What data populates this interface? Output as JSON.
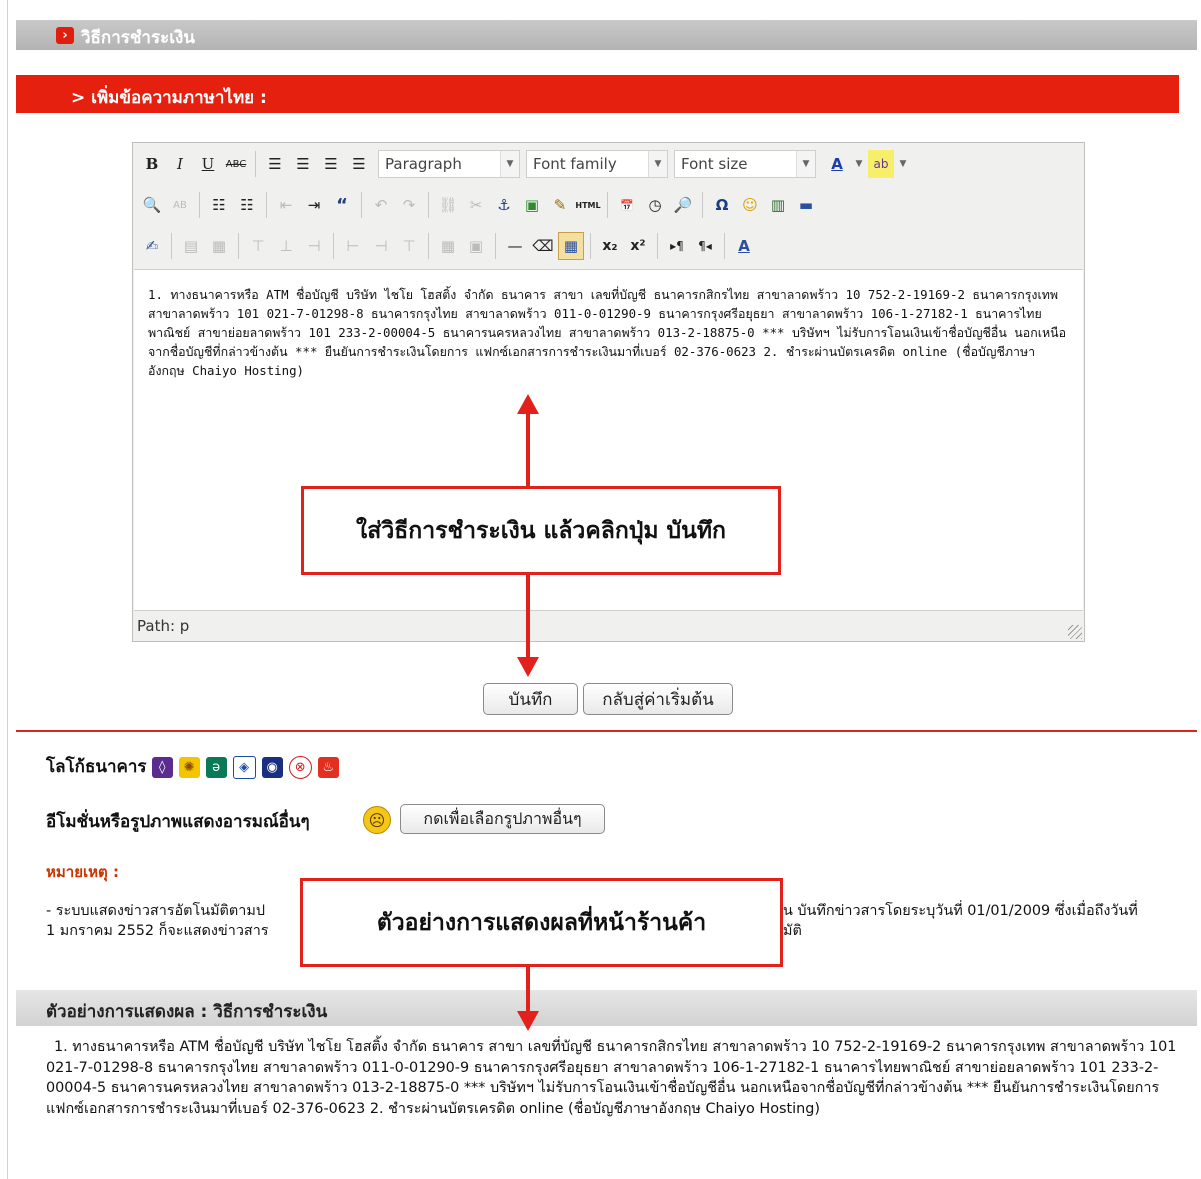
{
  "header": {
    "title": "วิธีการชำระเงิน",
    "bullet": "›"
  },
  "section": {
    "title": "> เพิ่มข้อความภาษาไทย :"
  },
  "editor": {
    "format_select": "Paragraph",
    "font_family_select": "Font family",
    "font_size_select": "Font size",
    "content": "1. ทางธนาคารหรือ ATM ชื่อบัญชี บริษัท ไชโย โฮสติ้ง จำกัด ธนาคาร สาขา เลขที่บัญชี ธนาคารกสิกรไทย สาขาลาดพร้าว 10 752-2-19169-2 ธนาคารกรุงเทพ สาขาลาดพร้าว 101 021-7-01298-8 ธนาคารกรุงไทย สาขาลาดพร้าว 011-0-01290-9 ธนาคารกรุงศรีอยุธยา สาขาลาดพร้าว 106-1-27182-1 ธนาคารไทยพาณิชย์ สาขาย่อยลาดพร้าว 101 233-2-00004-5 ธนาคารนครหลวงไทย สาขาลาดพร้าว 013-2-18875-0 *** บริษัทฯ ไม่รับการโอนเงินเข้าชื่อบัญชีอื่น นอกเหนือจากชื่อบัญชีที่กล่าวข้างต้น *** ยืนยันการชำระเงินโดยการ แฟกซ์เอกสารการชำระเงินมาที่เบอร์ 02-376-0623 2. ชำระผ่านบัตรเครดิต online (ชื่อบัญชีภาษาอังกฤษ Chaiyo Hosting)",
    "path": "Path: p"
  },
  "buttons": {
    "save": "บันทึก",
    "reset": "กลับสู่ค่าเริ่มต้น"
  },
  "callouts": {
    "top": "ใส่วิธีการชำระเงิน แล้วคลิกปุ่ม บันทึก",
    "bottom": "ตัวอย่างการแสดงผลที่หน้าร้านค้า"
  },
  "bank_logos": {
    "label": "โลโก้ธนาคาร"
  },
  "emoticons": {
    "label": "อีโมชั่นหรือรูปภาพแสดงอารมณ์อื่นๆ",
    "button": "กดเพื่อเลือกรูปภาพอื่นๆ"
  },
  "note": {
    "title": "หมายเหตุ :",
    "line1_left": "- ระบบแสดงข่าวสารอัตโนมัติตามป",
    "line1_right": "น บันทึกข่าวสารโดยระบุวันที่ 01/01/2009 ซึ่งเมื่อถึงวันที่",
    "line2_left": "1 มกราคม 2552 ก็จะแสดงข่าวสาร",
    "line2_right": "มัติ"
  },
  "preview": {
    "title": "ตัวอย่างการแสดงผล : วิธีการชำระเงิน",
    "text": "1. ทางธนาคารหรือ ATM ชื่อบัญชี บริษัท ไชโย โฮสติ้ง จำกัด ธนาคาร สาขา เลขที่บัญชี ธนาคารกสิกรไทย สาขาลาดพร้าว 10 752-2-19169-2 ธนาคารกรุงเทพ สาขาลาดพร้าว 101 021-7-01298-8 ธนาคารกรุงไทย สาขาลาดพร้าว 011-0-01290-9 ธนาคารกรุงศรีอยุธยา สาขาลาดพร้าว 106-1-27182-1 ธนาคารไทยพาณิชย์ สาขาย่อยลาดพร้าว 101 233-2-00004-5 ธนาคารนครหลวงไทย สาขาลาดพร้าว 013-2-18875-0 *** บริษัทฯ ไม่รับการโอนเงินเข้าชื่อบัญชีอื่น นอกเหนือจากชื่อบัญชีที่กล่าวข้างต้น *** ยืนยันการชำระเงินโดยการ แฟกซ์เอกสารการชำระเงินมาที่เบอร์ 02-376-0623 2. ชำระผ่านบัตรเครดิต online (ชื่อบัญชีภาษาอังกฤษ Chaiyo Hosting)"
  },
  "colors": {
    "accent_red": "#e6200f",
    "callout_red": "#e2201c",
    "note_red": "#cc3300"
  }
}
